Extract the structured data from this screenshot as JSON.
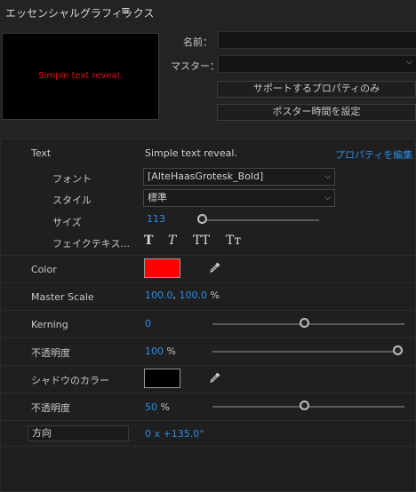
{
  "header": {
    "title": "エッセンシャルグラフィックス",
    "menu_icon": "hamburger-menu-icon"
  },
  "preview": {
    "text": "Simple text reveal."
  },
  "meta": {
    "name_label": "名前：",
    "master_label": "マスター：",
    "support_props_button": "サポートするプロパティのみ",
    "poster_time_button": "ポスター時間を設定"
  },
  "props": {
    "text_label": "Text",
    "text_value": "Simple text reveal.",
    "edit_props_link": "プロパティを編集",
    "font_label": "フォント",
    "font_value": "[AlteHaasGrotesk_Bold]",
    "style_label": "スタイル",
    "style_value": "標準",
    "size_label": "サイズ",
    "size_value": "113",
    "faux_label": "フェイクテキス...",
    "faux_buttons": [
      "T",
      "T",
      "TT",
      "Tт"
    ],
    "color_label": "Color",
    "color_value": "#ff0000",
    "master_scale_label": "Master Scale",
    "scale_x": "100.0",
    "scale_sep": ",",
    "scale_y": "100.0",
    "scale_unit": "%",
    "kerning_label": "Kerning",
    "kerning_value": "0",
    "opacity_label": "不透明度",
    "opacity_value": "100",
    "opacity_unit": "%",
    "shadow_color_label": "シャドウのカラー",
    "shadow_color_value": "#000000",
    "shadow_opacity_label": "不透明度",
    "shadow_opacity_value": "50",
    "shadow_opacity_unit": "%",
    "direction_label": "方向",
    "direction_value": "0 x +135.0°"
  }
}
